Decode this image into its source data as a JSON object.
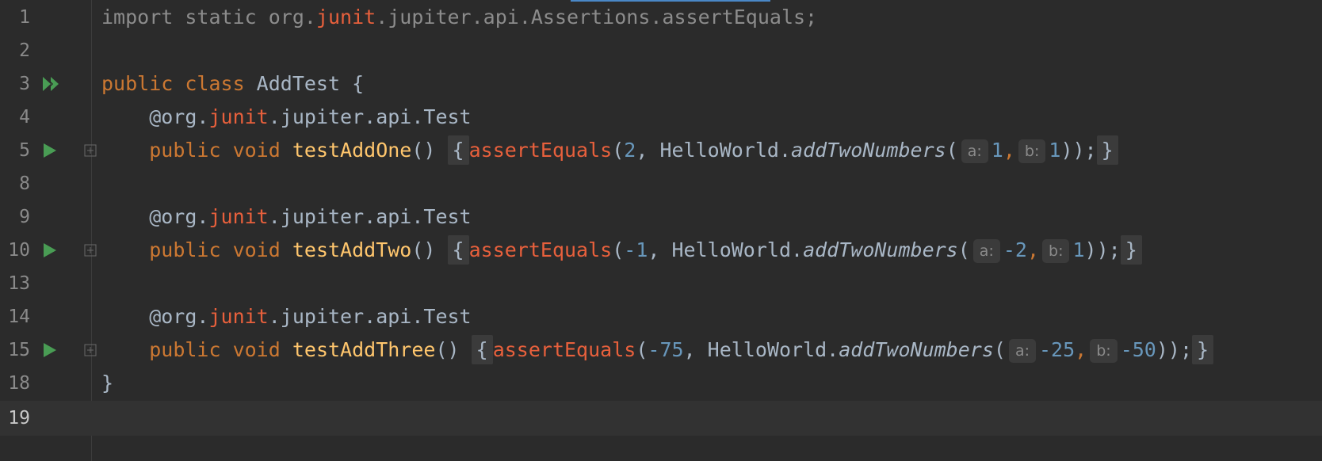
{
  "editor": {
    "lines": {
      "l1": {
        "num": "1",
        "t1": "import static org.",
        "t2": "junit",
        "t3": ".jupiter.api.Assertions.assertEquals;"
      },
      "l2": {
        "num": "2"
      },
      "l3": {
        "num": "3",
        "t1": "public class ",
        "t2": "AddTest {"
      },
      "l4": {
        "num": "4",
        "t1": "    @org.",
        "t2": "junit",
        "t3": ".jupiter.api.Test"
      },
      "l5": {
        "num": "5",
        "indent": "    ",
        "kw": "public void ",
        "fn": "testAddOne",
        "paren": "()",
        "sp": " ",
        "ob": "{",
        "ae": "assertEquals",
        "p1": "(",
        "n1": "2",
        "c1": ", HelloWorld.",
        "m": "addTwoNumbers",
        "p2": "(",
        "ha": "a:",
        "a": "1",
        "c2": ",",
        "hb": "b:",
        "b": "1",
        "close": "));",
        "cb": "}"
      },
      "l8": {
        "num": "8"
      },
      "l9": {
        "num": "9",
        "t1": "    @org.",
        "t2": "junit",
        "t3": ".jupiter.api.Test"
      },
      "l10": {
        "num": "10",
        "indent": "    ",
        "kw": "public void ",
        "fn": "testAddTwo",
        "paren": "()",
        "sp": " ",
        "ob": "{",
        "ae": "assertEquals",
        "p1": "(",
        "n1": "-1",
        "c1": ", HelloWorld.",
        "m": "addTwoNumbers",
        "p2": "(",
        "ha": "a:",
        "a": "-2",
        "c2": ",",
        "hb": "b:",
        "b": "1",
        "close": "));",
        "cb": "}"
      },
      "l13": {
        "num": "13"
      },
      "l14": {
        "num": "14",
        "t1": "    @org.",
        "t2": "junit",
        "t3": ".jupiter.api.Test"
      },
      "l15": {
        "num": "15",
        "indent": "    ",
        "kw": "public void ",
        "fn": "testAddThree",
        "paren": "()",
        "sp": " ",
        "ob": "{",
        "ae": "assertEquals",
        "p1": "(",
        "n1": "-75",
        "c1": ", HelloWorld.",
        "m": "addTwoNumbers",
        "p2": "(",
        "ha": "a:",
        "a": "-25",
        "c2": ",",
        "hb": "b:",
        "b": "-50",
        "close": "));",
        "cb": "}"
      },
      "l18": {
        "num": "18",
        "t1": "}"
      },
      "l19": {
        "num": "19"
      }
    },
    "colors": {
      "background": "#2b2b2b",
      "keyword": "#cc7832",
      "number": "#6897bb",
      "method": "#ffc66d",
      "run_icon": "#499c54"
    },
    "icons": {
      "run_all": "run-all-tests-icon",
      "run": "run-test-icon",
      "fold": "fold-icon"
    }
  }
}
